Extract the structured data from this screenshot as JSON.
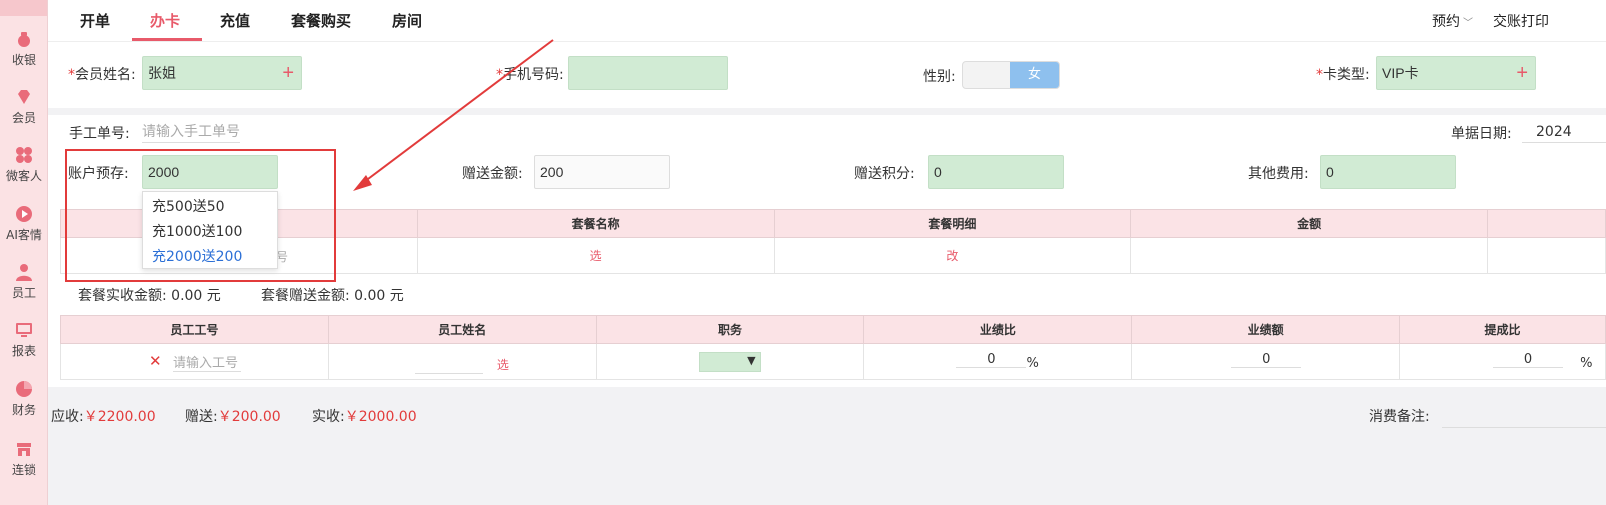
{
  "sidebar": {
    "items": [
      {
        "label": "收银",
        "icon": "cash-register-icon"
      },
      {
        "label": "会员",
        "icon": "diamond-icon"
      },
      {
        "label": "微客人",
        "icon": "grid-icon"
      },
      {
        "label": "AI客情",
        "icon": "play-circle-icon"
      },
      {
        "label": "员工",
        "icon": "person-icon"
      },
      {
        "label": "报表",
        "icon": "monitor-icon"
      },
      {
        "label": "财务",
        "icon": "pie-chart-icon"
      },
      {
        "label": "连锁",
        "icon": "store-icon"
      }
    ]
  },
  "tabs": [
    "开单",
    "办卡",
    "充值",
    "套餐购买",
    "房间"
  ],
  "active_tab": "办卡",
  "header_right": {
    "reserve": "预约",
    "checkout_print": "交账打印"
  },
  "member": {
    "name_label": "会员姓名:",
    "name_value": "张姐",
    "phone_label": "手机号码:",
    "phone_value": "",
    "gender_label": "性别:",
    "gender_value": "女",
    "card_type_label": "卡类型:",
    "card_type_value": "VIP卡",
    "required_mark": "*"
  },
  "order": {
    "manual_no_label": "手工单号:",
    "manual_no_placeholder": "请输入手工单号",
    "date_label": "单据日期:",
    "date_value": "2024",
    "deposit_label": "账户预存:",
    "deposit_value": "2000",
    "gift_amount_label": "赠送金额:",
    "gift_amount_value": "200",
    "gift_points_label": "赠送积分:",
    "gift_points_value": "0",
    "other_fee_label": "其他费用:",
    "other_fee_value": "0"
  },
  "deposit_dropdown": {
    "options": [
      "充500送50",
      "充1000送100",
      "充2000送200"
    ],
    "selected": "充2000送200"
  },
  "package_table": {
    "headers": [
      "",
      "套餐名称",
      "套餐明细",
      "金额",
      ""
    ],
    "row": {
      "partial": "号",
      "select": "选",
      "edit": "改"
    }
  },
  "package_summary": {
    "actual_label": "套餐实收金额:",
    "actual_value": "0.00 元",
    "gift_label": "套餐赠送金额:",
    "gift_value": "0.00 元"
  },
  "staff_table": {
    "headers": [
      "员工工号",
      "员工姓名",
      "职务",
      "业绩比",
      "业绩额",
      "提成比"
    ],
    "row": {
      "remove": "✕",
      "staff_no_placeholder": "请输入工号",
      "select": "选",
      "ratio": "0",
      "percent": "%",
      "amount": "0",
      "commission": "0",
      "commission_percent": "%"
    }
  },
  "totals": {
    "due_label": "应收:",
    "due_value": "￥2200.00",
    "gift_label": "赠送:",
    "gift_value": "￥200.00",
    "paid_label": "实收:",
    "paid_value": "￥2000.00",
    "remark_label": "消费备注:"
  },
  "colors": {
    "accent": "#e85a6a",
    "input_green": "#d1ebd4",
    "toggle_blue": "#8ec0ee",
    "highlight_red": "#e23b3b",
    "table_header": "#fbe3e6"
  }
}
